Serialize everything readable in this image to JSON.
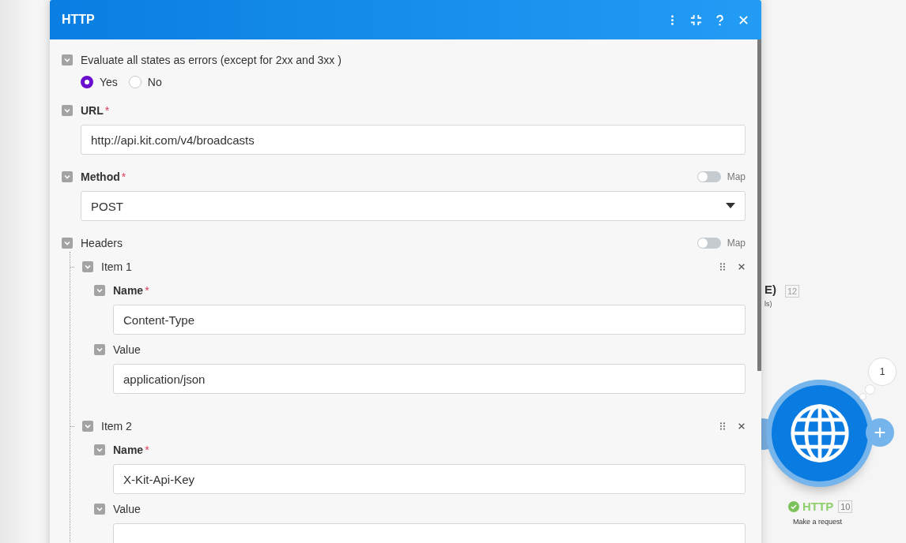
{
  "canvas": {
    "partial_title": "E)",
    "partial_subtitle": "ls)",
    "partial_badge": "12",
    "node": {
      "bubble": "1",
      "title": "HTTP",
      "badge": "10",
      "subtitle": "Make a request"
    }
  },
  "dialog": {
    "title": "HTTP",
    "sections": [
      {
        "kind": "radio",
        "label": "Evaluate all states as errors (except for 2xx and 3xx )",
        "options": [
          {
            "label": "Yes",
            "selected": true
          },
          {
            "label": "No",
            "selected": false
          }
        ]
      },
      {
        "kind": "text",
        "label": "URL",
        "required_mark": "*",
        "value": "http://api.kit.com/v4/broadcasts"
      },
      {
        "kind": "select",
        "label": "Method",
        "required_mark": "*",
        "map": {
          "label": "Map",
          "on": false
        },
        "value": "POST"
      },
      {
        "kind": "array",
        "label": "Headers",
        "map": {
          "label": "Map",
          "on": false
        },
        "items": [
          {
            "label": "Item 1",
            "fields": [
              {
                "label": "Name",
                "required_mark": "*",
                "value": "Content-Type"
              },
              {
                "label": "Value",
                "value": "application/json"
              }
            ]
          },
          {
            "label": "Item 2",
            "fields": [
              {
                "label": "Name",
                "required_mark": "*",
                "value": "X-Kit-Api-Key"
              },
              {
                "label": "Value"
              }
            ]
          }
        ]
      }
    ]
  }
}
